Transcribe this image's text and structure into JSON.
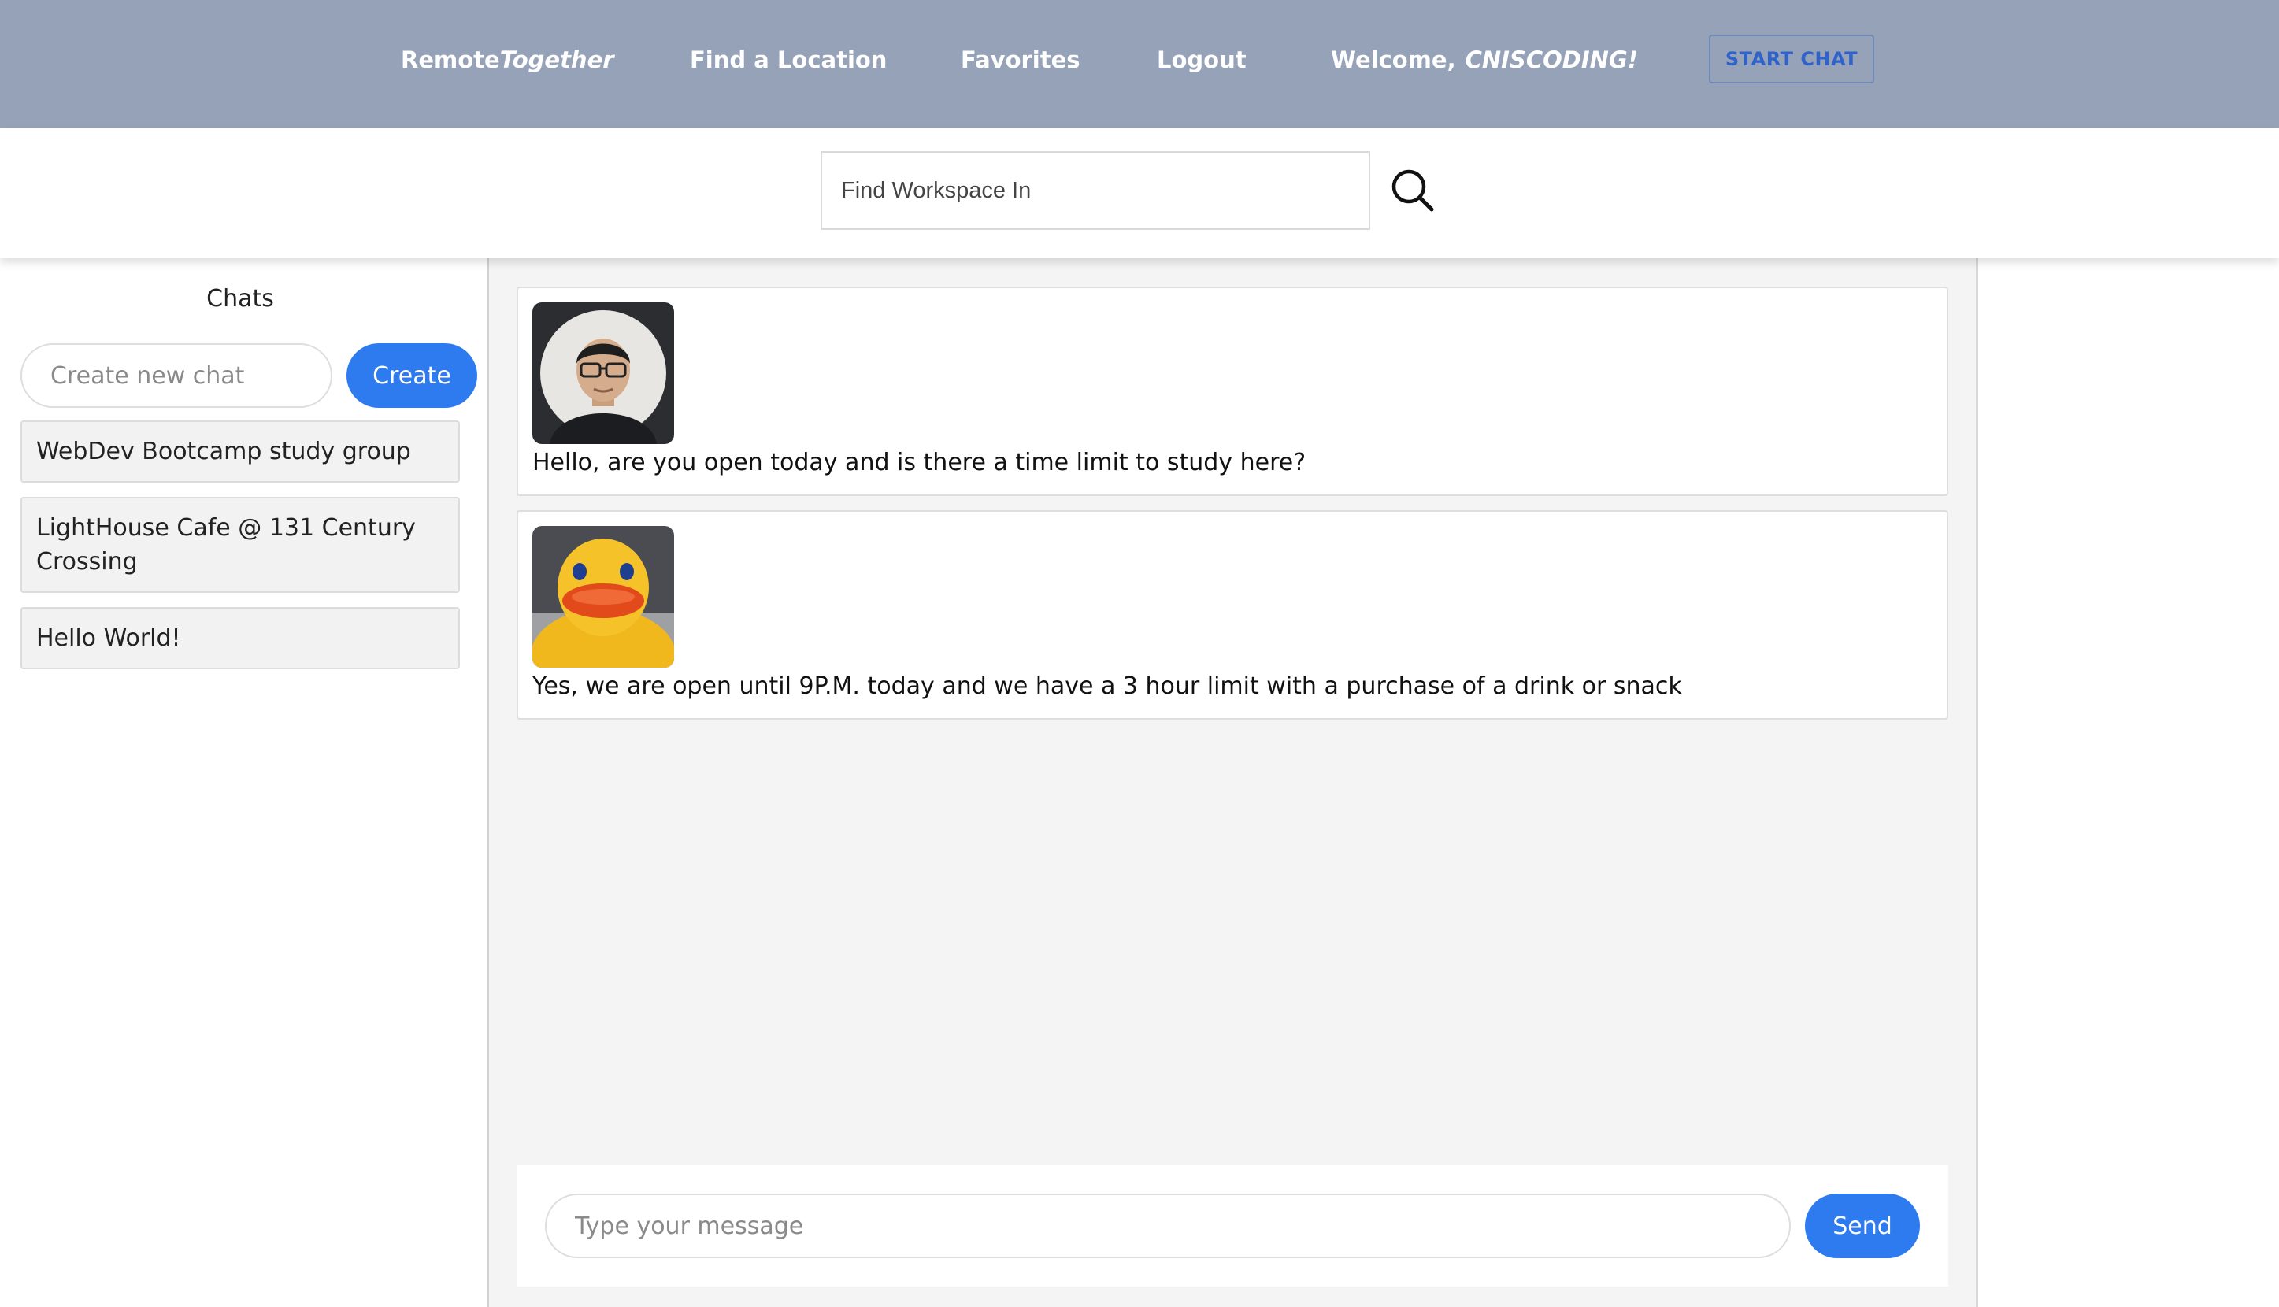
{
  "nav": {
    "brand_plain": "Remote",
    "brand_italic": "Together",
    "find_location": "Find a Location",
    "favorites": "Favorites",
    "logout": "Logout",
    "welcome_label": "Welcome,",
    "welcome_user": "CNISCODING!",
    "start_chat": "START CHAT"
  },
  "search": {
    "placeholder": "Find Workspace In",
    "icon": "search-icon"
  },
  "sidebar": {
    "title": "Chats",
    "new_chat_placeholder": "Create new chat",
    "create_label": "Create",
    "chats": [
      {
        "name": "WebDev Bootcamp study group"
      },
      {
        "name": "LightHouse Cafe @ 131 Century Crossing"
      },
      {
        "name": "Hello World!"
      }
    ]
  },
  "messages": [
    {
      "avatar": "user-avatar-man",
      "text": "Hello, are you open today and is there a time limit to study here?"
    },
    {
      "avatar": "user-avatar-rubber-duck",
      "text": "Yes, we are open until 9P.M. today and we have a 3 hour limit with a purchase of a drink or snack"
    }
  ],
  "composer": {
    "placeholder": "Type your message",
    "send_label": "Send"
  },
  "colors": {
    "nav_bg": "#95a2b8",
    "accent": "#2e7bf0",
    "panel_bg": "#f4f4f4"
  }
}
